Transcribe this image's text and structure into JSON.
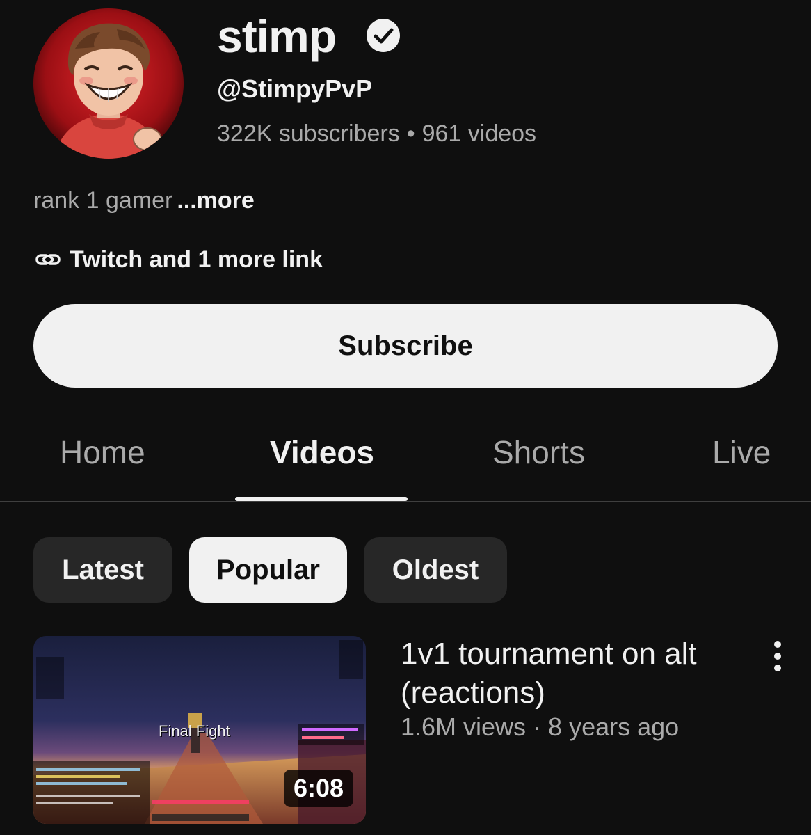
{
  "channel": {
    "name": "stimp",
    "handle": "@StimpyPvP",
    "subscribers": "322K subscribers",
    "stats_separator": "•",
    "videos": "961 videos",
    "description": "rank 1 gamer",
    "more_label": "...more",
    "links_label": "Twitch and 1 more link",
    "verified_icon": "verified-check-icon",
    "link_icon": "link-icon"
  },
  "subscribe": {
    "label": "Subscribe"
  },
  "tabs": [
    {
      "label": "Home"
    },
    {
      "label": "Videos"
    },
    {
      "label": "Shorts"
    },
    {
      "label": "Live"
    }
  ],
  "active_tab": "Videos",
  "chips": [
    {
      "label": "Latest"
    },
    {
      "label": "Popular"
    },
    {
      "label": "Oldest"
    }
  ],
  "selected_chip": "Popular",
  "video": {
    "title": "1v1 tournament on alt (reactions)",
    "meta": "1.6M views · 8 years ago",
    "duration": "6:08",
    "thumbnail_overlay": "Final Fight",
    "more_icon": "vertical-dots-icon"
  },
  "colors": {
    "background": "#0f0f0f",
    "text_primary": "#f1f1f1",
    "text_secondary": "#aaaaaa",
    "chip_bg": "#272727"
  }
}
